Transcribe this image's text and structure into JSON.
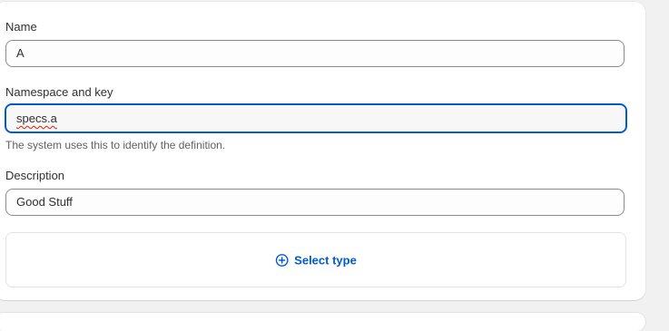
{
  "form": {
    "name": {
      "label": "Name",
      "value": "A"
    },
    "namespace": {
      "label": "Namespace and key",
      "value": "specs.a",
      "help_text": "The system uses this to identify the definition."
    },
    "description": {
      "label": "Description",
      "value": "Good Stuff"
    },
    "select_type": {
      "label": "Select type",
      "icon": "plus-circle-icon"
    }
  },
  "colors": {
    "accent": "#005bd3",
    "focus_border": "#005bd3",
    "spellcheck_underline": "#e51c00"
  }
}
